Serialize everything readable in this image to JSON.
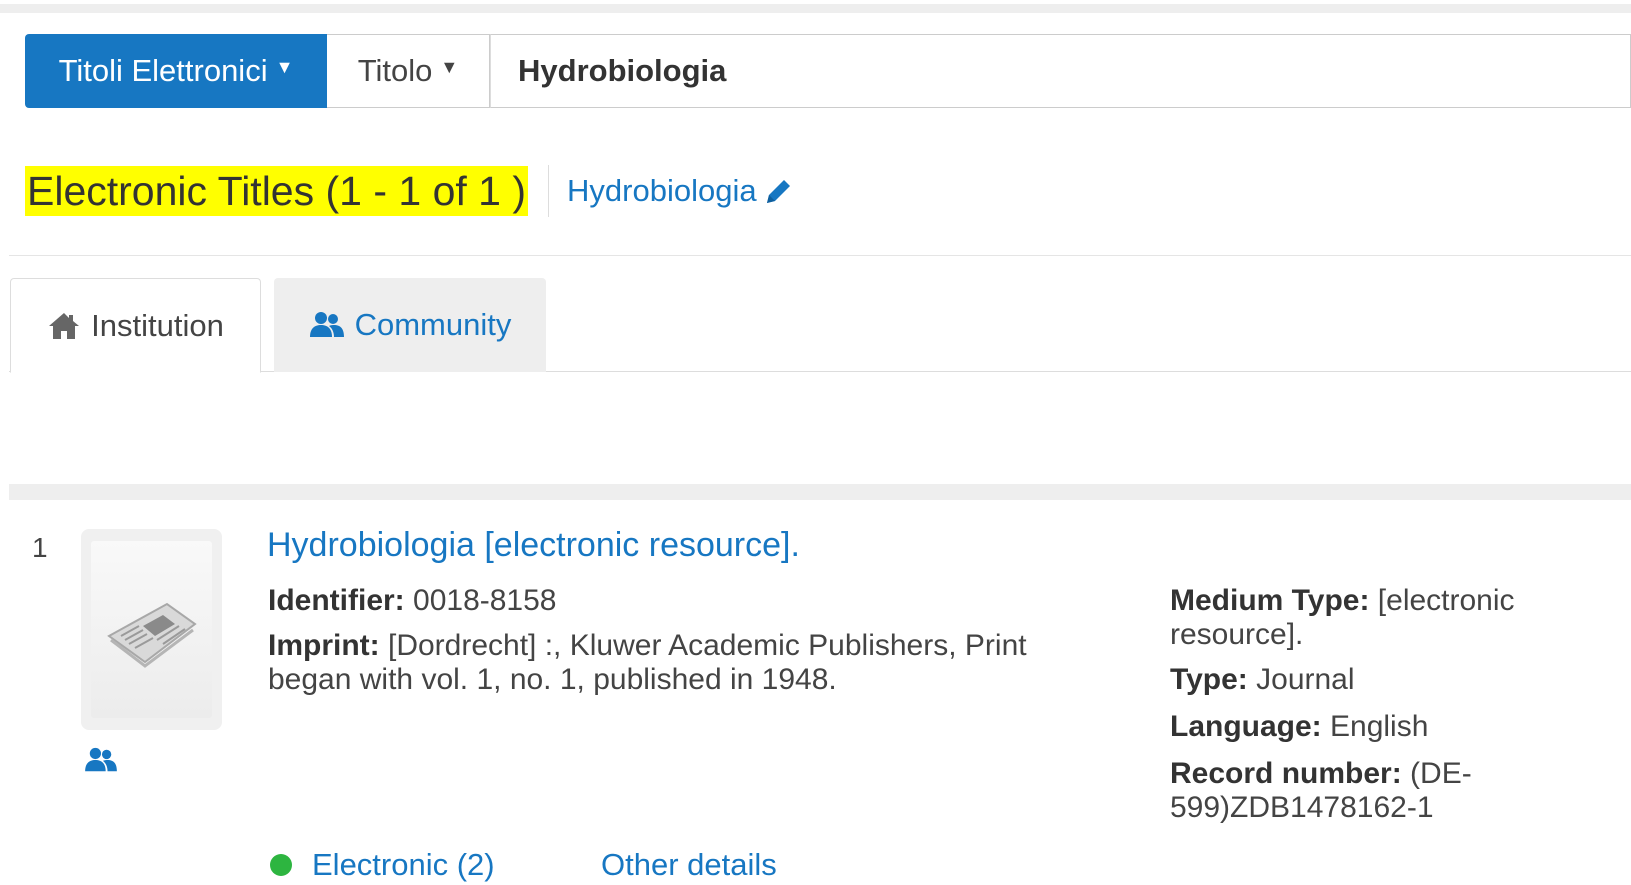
{
  "search": {
    "scope_label": "Titoli Elettronici",
    "field_label": "Titolo",
    "query_value": "Hydrobiologia"
  },
  "results_header": {
    "title": "Electronic Titles (1 - 1 of 1 )",
    "query_link": "Hydrobiologia"
  },
  "tabs": [
    {
      "label": "Institution",
      "icon": "home-icon",
      "active": true
    },
    {
      "label": "Community",
      "icon": "users-icon",
      "active": false
    }
  ],
  "result": {
    "rank": "1",
    "title": "Hydrobiologia [electronic resource].",
    "identifier": {
      "label": "Identifier:",
      "value": "0018-8158"
    },
    "imprint": {
      "label": "Imprint:",
      "value": "[Dordrecht] :, Kluwer Academic Publishers, Print began with vol. 1, no. 1, published in 1948."
    },
    "medium_type": {
      "label": "Medium Type:",
      "value": "[electronic resource]."
    },
    "type": {
      "label": "Type:",
      "value": "Journal"
    },
    "language": {
      "label": "Language:",
      "value": "English"
    },
    "record_number": {
      "label": "Record number:",
      "value": "(DE-599)ZDB1478162-1"
    },
    "availability": "Electronic (2)",
    "other_details": "Other details"
  },
  "colors": {
    "primary": "#1777c2",
    "highlight": "#ffff00",
    "available": "#2db540"
  }
}
